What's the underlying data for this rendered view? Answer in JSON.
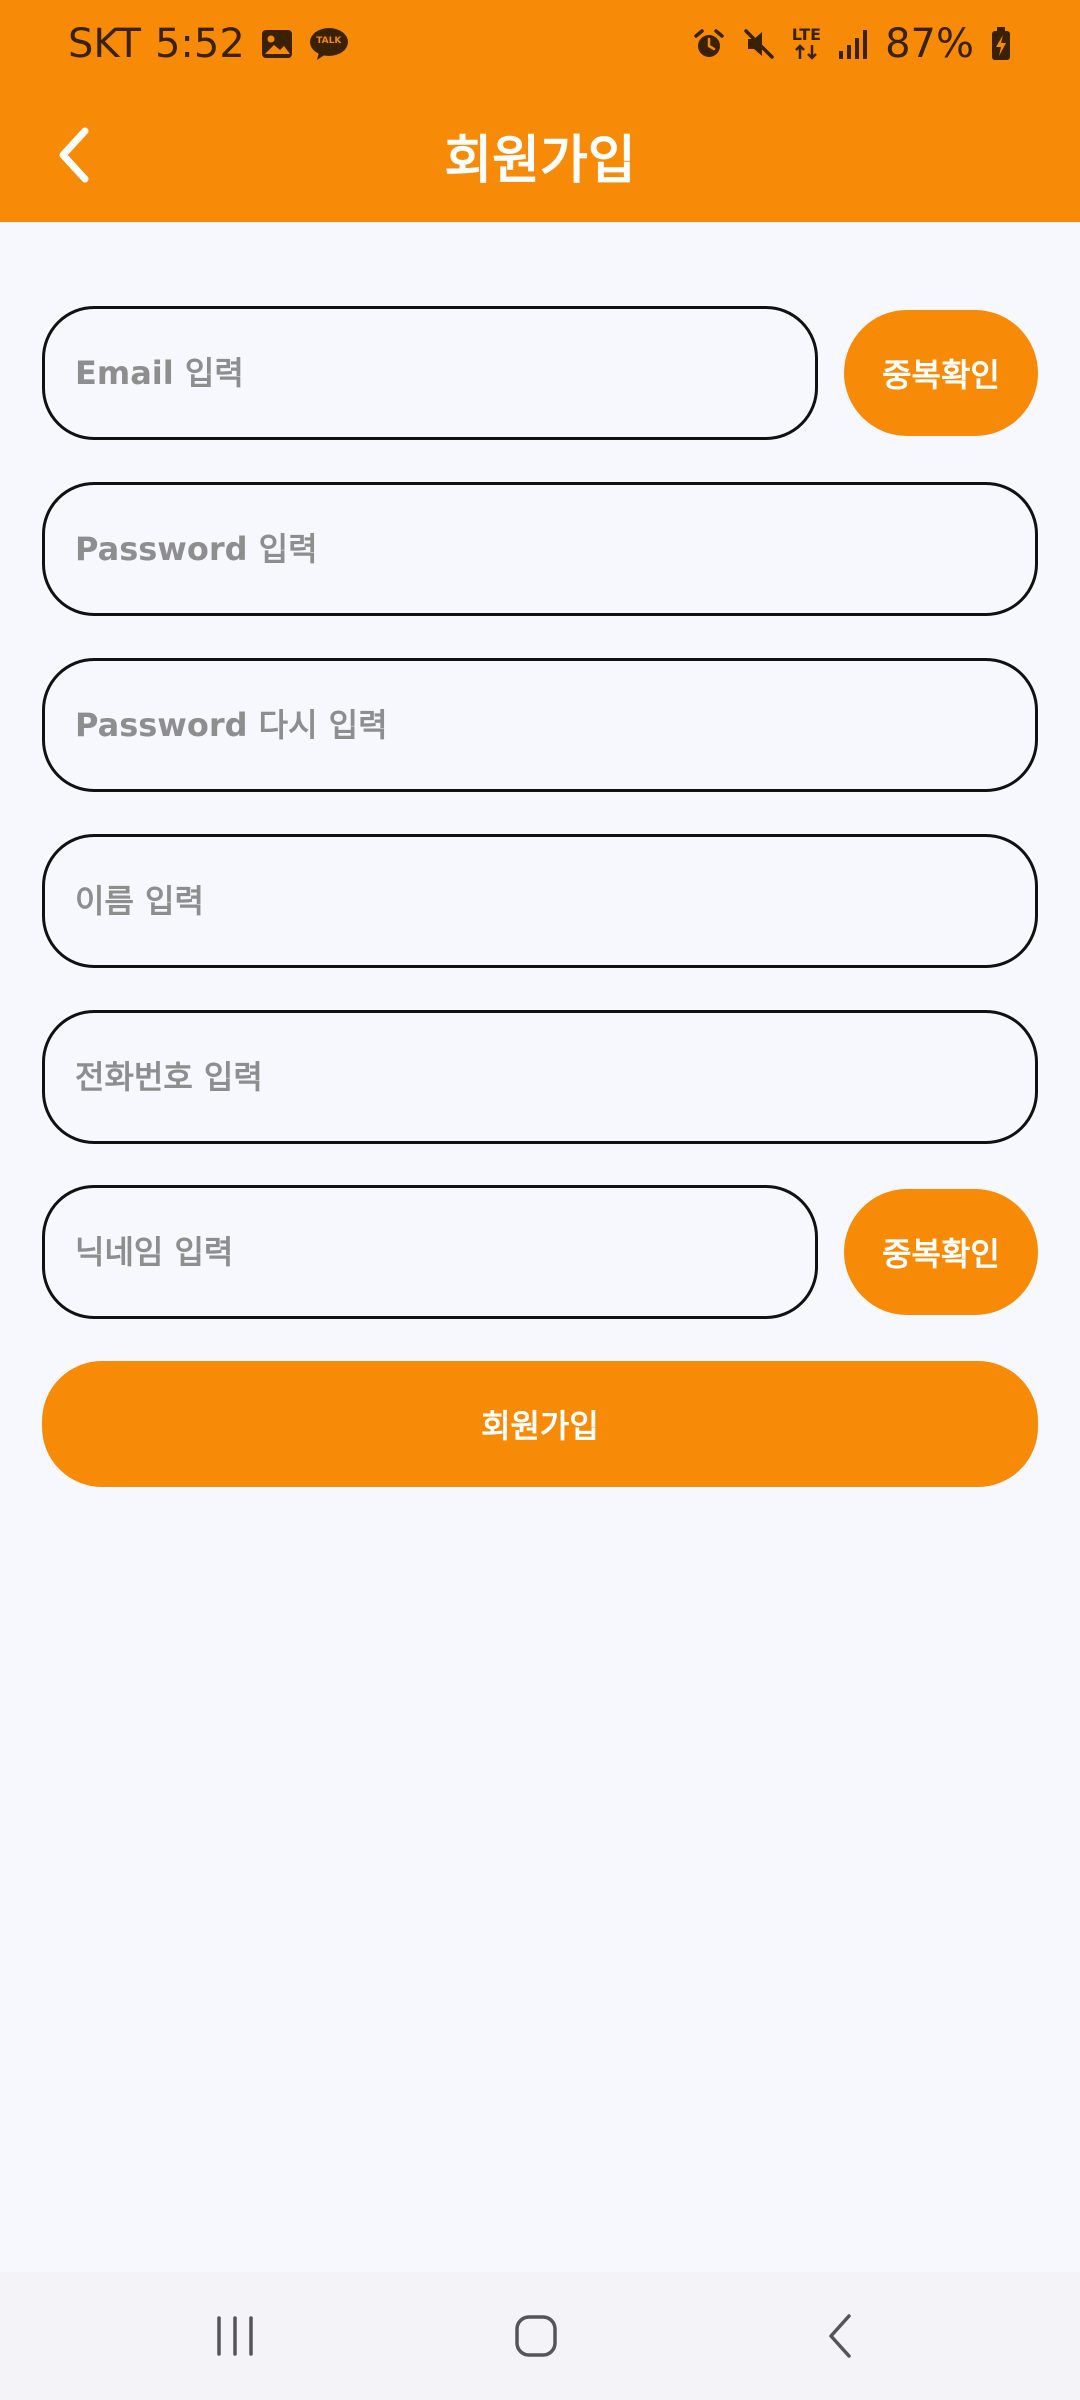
{
  "status_bar": {
    "carrier": "SKT",
    "time": "5:52",
    "network": "LTE",
    "battery": "87%",
    "icons": [
      "gallery-icon",
      "kakaotalk-icon",
      "alarm-icon",
      "mute-icon",
      "lte-icon",
      "signal-icon",
      "battery-charging-icon"
    ],
    "talk_badge": "TALK"
  },
  "app_bar": {
    "title": "회원가입",
    "back_icon": "chevron-left-icon"
  },
  "form": {
    "email": {
      "placeholder": "Email 입력",
      "value": ""
    },
    "email_check_button": "중복확인",
    "password": {
      "placeholder": "Password 입력",
      "value": ""
    },
    "password_confirm": {
      "placeholder": "Password 다시 입력",
      "value": ""
    },
    "name": {
      "placeholder": "이름 입력",
      "value": ""
    },
    "phone": {
      "placeholder": "전화번호 입력",
      "value": ""
    },
    "nickname": {
      "placeholder": "닉네임 입력",
      "value": ""
    },
    "nickname_check_button": "중복확인",
    "submit_button": "회원가입"
  },
  "nav_bar": {
    "items": [
      "recent-apps-icon",
      "home-icon",
      "back-icon"
    ]
  },
  "colors": {
    "accent": "#f78b08",
    "background": "#f7f8fd",
    "placeholder": "#8e8e8e",
    "border": "#111111",
    "nav_bar": "#f4f4f8"
  }
}
